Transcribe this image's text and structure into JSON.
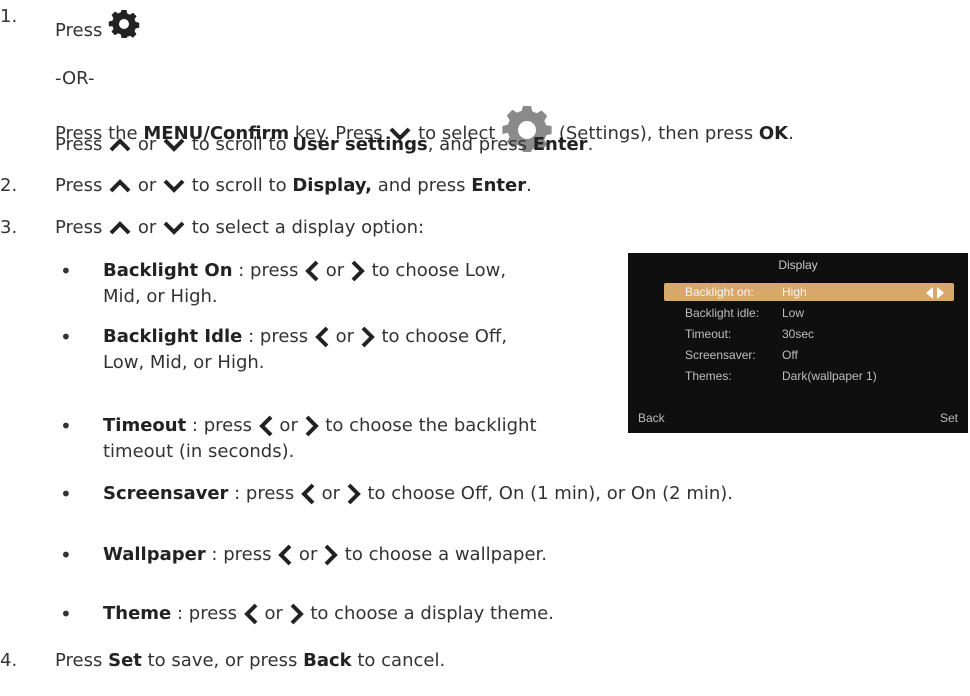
{
  "steps": {
    "n1": "1.",
    "n2": "2.",
    "n3": "3.",
    "n4": "4.",
    "s1_press": "Press",
    "s1_or": "-OR-",
    "s1_l3_a": "Press the ",
    "s1_l3_menu": "MENU/Confirm",
    "s1_l3_b": " key. Press ",
    "s1_l3_c": " to select ",
    "s1_l3_d": " (Settings), then press ",
    "s1_l3_ok": "OK",
    "s1_l3_e": ".",
    "s1_l4_a": "Press ",
    "s1_l4_or": " or ",
    "s1_l4_b": " to scroll to ",
    "s1_l4_user": "User settings",
    "s1_l4_c": ", and press ",
    "s1_l4_enter": "Enter",
    "s1_l4_d": ".",
    "s2_a": "Press ",
    "s2_or": " or ",
    "s2_b": " to scroll to ",
    "s2_display": "Display,",
    "s2_c": " and press ",
    "s2_enter": "Enter",
    "s2_d": ".",
    "s3_a": "Press ",
    "s3_or": " or ",
    "s3_b": " to select a display option:",
    "s4_a": "Press ",
    "s4_set": "Set",
    "s4_b": " to save, or press ",
    "s4_back": "Back",
    "s4_c": " to cancel."
  },
  "options": [
    {
      "name": "Backlight On",
      "pre": " : press ",
      "or": " or ",
      "desc1": " to  choose Low,",
      "desc2": "Mid, or High."
    },
    {
      "name": "Backlight Idle",
      "pre": " : press ",
      "or": " or ",
      "desc1": " to  choose Off,",
      "desc2": "Low, Mid, or High."
    },
    {
      "name": "Timeout",
      "pre": " : press ",
      "or": " or ",
      "desc1": " to  choose the backlight",
      "desc2": "timeout (in seconds)."
    },
    {
      "name": "Screensaver",
      "pre": " : press ",
      "or": " or ",
      "desc1": " to  choose Off, On (1 min), or On (2 min)."
    },
    {
      "name": "Wallpaper",
      "pre": " : press ",
      "or": " or ",
      "desc1": " to  choose a wallpaper."
    },
    {
      "name": "Theme",
      "pre": " : press ",
      "or": " or ",
      "desc1": " to  choose a display theme."
    }
  ],
  "bullet": "•",
  "screen": {
    "title": "Display",
    "rows": [
      {
        "label": "Backlight on:",
        "value": "High"
      },
      {
        "label": "Backlight idle:",
        "value": "Low"
      },
      {
        "label": "Timeout:",
        "value": "30sec"
      },
      {
        "label": "Screensaver:",
        "value": "Off"
      },
      {
        "label": "Themes:",
        "value": "Dark(wallpaper 1)"
      }
    ],
    "back": "Back",
    "set": "Set",
    "highlight_color": "#d8a86b"
  },
  "icons": {
    "gear_small": "gear-icon",
    "gear_large": "settings-icon",
    "up": "chevron-up-icon",
    "down": "chevron-down-icon",
    "left": "chevron-left-icon",
    "right": "chevron-right-icon"
  }
}
